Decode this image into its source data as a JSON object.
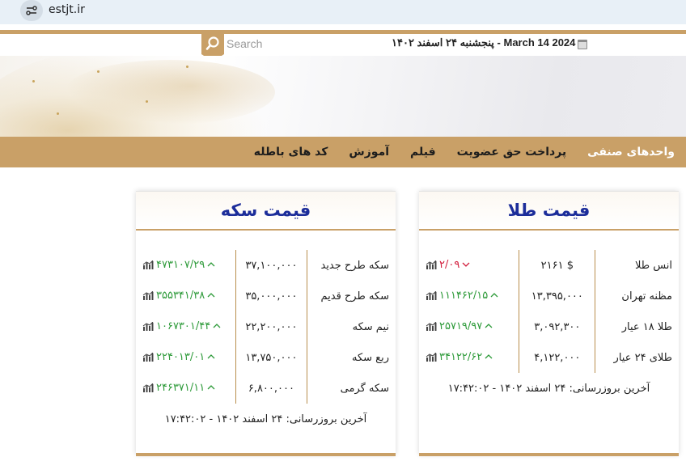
{
  "browser": {
    "url": "estjt.ir"
  },
  "header": {
    "search_placeholder": "Search",
    "date": "پنجشنبه ۲۴ اسفند ۱۴۰۲ - March 14 2024"
  },
  "nav": {
    "items": [
      "واحدهای صنفی",
      "پرداخت حق عضویت",
      "فیلم",
      "آموزش",
      "کد های باطله"
    ]
  },
  "gold_card": {
    "title": "قیمت طلا",
    "rows": [
      {
        "name": "انس طلا",
        "value": "$ ۲۱۶۱",
        "change": "۲/۰۹",
        "direction": "down"
      },
      {
        "name": "مظنه تهران",
        "value": "۱۳,۳۹۵,۰۰۰",
        "change": "۱۱۱۴۶۲/۱۵",
        "direction": "up"
      },
      {
        "name": "طلا ۱۸ عیار",
        "value": "۳,۰۹۲,۳۰۰",
        "change": "۲۵۷۱۹/۹۷",
        "direction": "up"
      },
      {
        "name": "طلای ۲۴ عیار",
        "value": "۴,۱۲۲,۰۰۰",
        "change": "۳۴۱۲۲/۶۲",
        "direction": "up"
      }
    ],
    "updated": "آخرین بروزرسانی: ۲۴ اسفند ۱۴۰۲ - ۱۷:۴۲:۰۲"
  },
  "coin_card": {
    "title": "قیمت سکه",
    "rows": [
      {
        "name": "سکه طرح جدید",
        "value": "۳۷,۱۰۰,۰۰۰",
        "change": "۴۷۳۱۰۷/۲۹",
        "direction": "up"
      },
      {
        "name": "سکه طرح قدیم",
        "value": "۳۵,۰۰۰,۰۰۰",
        "change": "۳۵۵۳۴۱/۳۸",
        "direction": "up"
      },
      {
        "name": "نیم سکه",
        "value": "۲۲,۲۰۰,۰۰۰",
        "change": "۱۰۶۷۳۰۱/۴۴",
        "direction": "up"
      },
      {
        "name": "ربع سکه",
        "value": "۱۳,۷۵۰,۰۰۰",
        "change": "۲۲۴۰۱۳/۰۱",
        "direction": "up"
      },
      {
        "name": "سکه گرمی",
        "value": "۶,۸۰۰,۰۰۰",
        "change": "۲۴۶۳۷۱/۱۱",
        "direction": "up"
      }
    ],
    "updated": "آخرین بروزرسانی: ۲۴ اسفند ۱۴۰۲ - ۱۷:۴۲:۰۲"
  },
  "colors": {
    "gold": "#c9a067",
    "title_blue": "#1c2d9a",
    "up": "#2d9a39",
    "down": "#d21d3c"
  },
  "icons": [
    "site-info-icon",
    "search-icon",
    "calendar-icon",
    "chart-bars-icon",
    "arrow-up-icon",
    "arrow-down-icon"
  ]
}
